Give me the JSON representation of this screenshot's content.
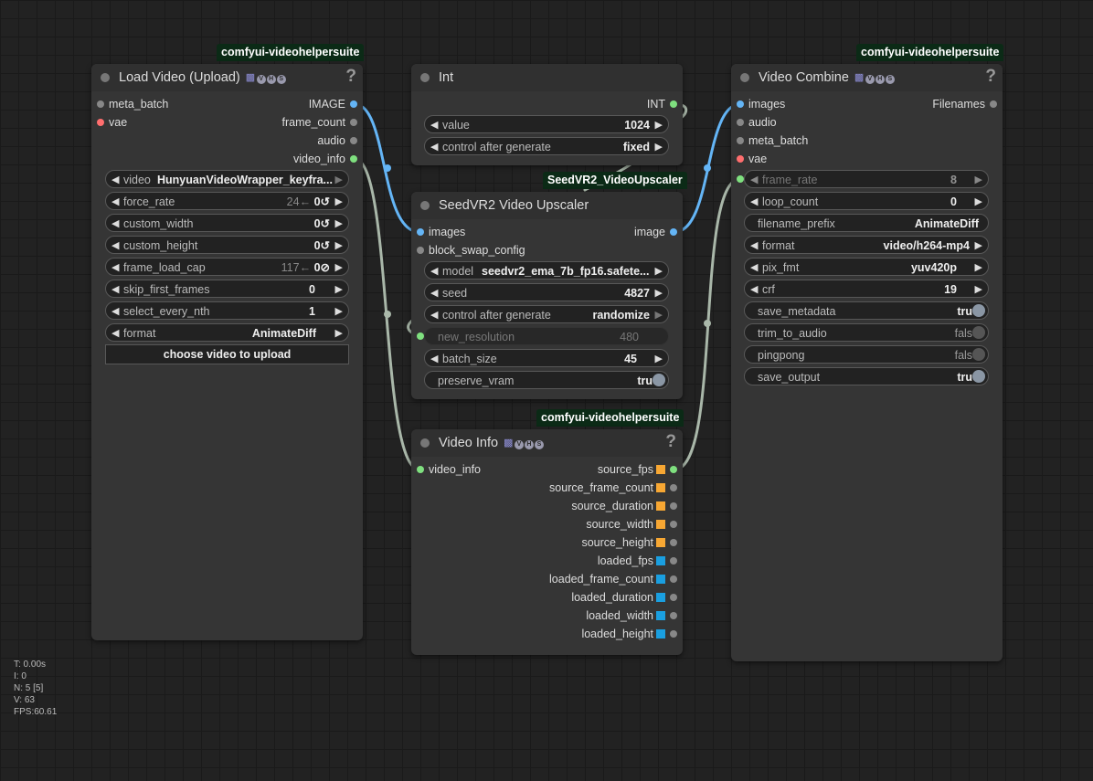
{
  "badges": {
    "load_video": "comfyui-videohelpersuite",
    "video_combine": "comfyui-videohelpersuite",
    "seedvr2": "SeedVR2_VideoUpscaler",
    "video_info": "comfyui-videohelpersuite"
  },
  "vhs_tag": {
    "icon": "film-icon",
    "letters": [
      "V",
      "H",
      "S"
    ]
  },
  "load_video": {
    "title": "Load Video (Upload)",
    "inputs": [
      "meta_batch",
      "vae"
    ],
    "outputs": [
      "IMAGE",
      "frame_count",
      "audio",
      "video_info"
    ],
    "widgets": {
      "video": {
        "label": "video",
        "value": "HunyuanVideoWrapper_keyfra..."
      },
      "force_rate": {
        "label": "force_rate",
        "hint": "24←",
        "value": "0↺"
      },
      "custom_width": {
        "label": "custom_width",
        "value": "0↺"
      },
      "custom_height": {
        "label": "custom_height",
        "value": "0↺"
      },
      "frame_load_cap": {
        "label": "frame_load_cap",
        "hint": "117←",
        "value": "0⊘"
      },
      "skip_first_frames": {
        "label": "skip_first_frames",
        "value": "0"
      },
      "select_every_nth": {
        "label": "select_every_nth",
        "value": "1"
      },
      "format": {
        "label": "format",
        "value": "AnimateDiff"
      }
    },
    "upload_button": "choose video to upload"
  },
  "int_node": {
    "title": "Int",
    "output": "INT",
    "widgets": {
      "value": {
        "label": "value",
        "value": "1024"
      },
      "control": {
        "label": "control after generate",
        "value": "fixed"
      }
    }
  },
  "seedvr2": {
    "title": "SeedVR2 Video Upscaler",
    "inputs": [
      "images",
      "block_swap_config"
    ],
    "output": "image",
    "widgets": {
      "model": {
        "label": "model",
        "value": "seedvr2_ema_7b_fp16.safete..."
      },
      "seed": {
        "label": "seed",
        "value": "4827"
      },
      "control": {
        "label": "control after generate",
        "value": "randomize"
      },
      "new_resolution": {
        "label": "new_resolution",
        "value": "480"
      },
      "batch_size": {
        "label": "batch_size",
        "value": "45"
      },
      "preserve_vram": {
        "label": "preserve_vram",
        "value": "true"
      }
    }
  },
  "video_info": {
    "title": "Video Info",
    "input": "video_info",
    "outputs": [
      {
        "label": "source_fps",
        "color": "#f7a733"
      },
      {
        "label": "source_frame_count",
        "color": "#f7a733"
      },
      {
        "label": "source_duration",
        "color": "#f7a733"
      },
      {
        "label": "source_width",
        "color": "#f7a733"
      },
      {
        "label": "source_height",
        "color": "#f7a733"
      },
      {
        "label": "loaded_fps",
        "color": "#1a9fe0"
      },
      {
        "label": "loaded_frame_count",
        "color": "#1a9fe0"
      },
      {
        "label": "loaded_duration",
        "color": "#1a9fe0"
      },
      {
        "label": "loaded_width",
        "color": "#1a9fe0"
      },
      {
        "label": "loaded_height",
        "color": "#1a9fe0"
      }
    ]
  },
  "video_combine": {
    "title": "Video Combine",
    "inputs": [
      "images",
      "audio",
      "meta_batch",
      "vae"
    ],
    "output": "Filenames",
    "widgets": {
      "frame_rate": {
        "label": "frame_rate",
        "value": "8"
      },
      "loop_count": {
        "label": "loop_count",
        "value": "0"
      },
      "filename_prefix": {
        "label": "filename_prefix",
        "value": "AnimateDiff"
      },
      "format": {
        "label": "format",
        "value": "video/h264-mp4"
      },
      "pix_fmt": {
        "label": "pix_fmt",
        "value": "yuv420p"
      },
      "crf": {
        "label": "crf",
        "value": "19"
      },
      "save_metadata": {
        "label": "save_metadata",
        "value": "true"
      },
      "trim_to_audio": {
        "label": "trim_to_audio",
        "value": "false"
      },
      "pingpong": {
        "label": "pingpong",
        "value": "false"
      },
      "save_output": {
        "label": "save_output",
        "value": "true"
      }
    }
  },
  "stats": {
    "t": "T: 0.00s",
    "i": "I: 0",
    "n": "N: 5 [5]",
    "v": "V: 63",
    "fps": "FPS:60.61"
  },
  "colors": {
    "link_image": "#64b5f6",
    "link_video_info": "#a9b7a9",
    "badge_bg": "#0b2a16",
    "node_bg": "#353535",
    "canvas_bg": "#222222"
  }
}
